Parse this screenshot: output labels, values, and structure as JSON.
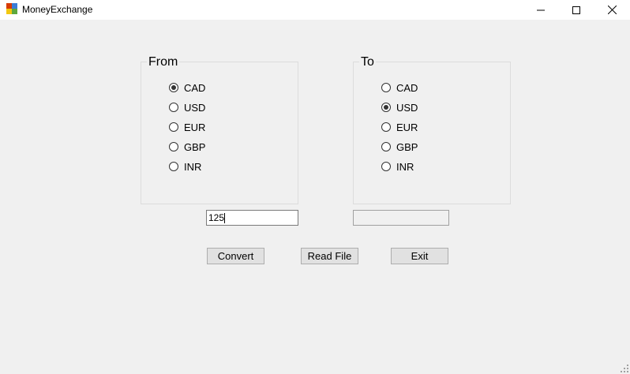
{
  "window": {
    "title": "MoneyExchange"
  },
  "from_group": {
    "title": "From",
    "options": [
      {
        "label": "CAD",
        "checked": true
      },
      {
        "label": "USD",
        "checked": false
      },
      {
        "label": "EUR",
        "checked": false
      },
      {
        "label": "GBP",
        "checked": false
      },
      {
        "label": "INR",
        "checked": false
      }
    ]
  },
  "to_group": {
    "title": "To",
    "options": [
      {
        "label": "CAD",
        "checked": false
      },
      {
        "label": "USD",
        "checked": true
      },
      {
        "label": "EUR",
        "checked": false
      },
      {
        "label": "GBP",
        "checked": false
      },
      {
        "label": "INR",
        "checked": false
      }
    ]
  },
  "amount_input": {
    "value": "125"
  },
  "result_output": {
    "value": ""
  },
  "buttons": {
    "convert": "Convert",
    "read_file": "Read File",
    "exit": "Exit"
  }
}
